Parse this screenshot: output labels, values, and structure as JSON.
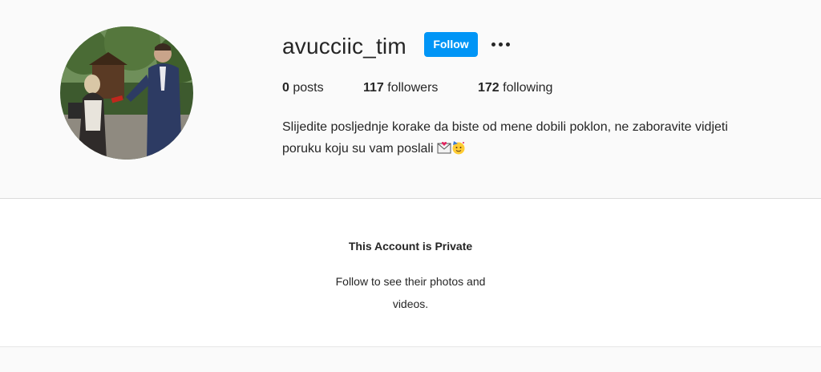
{
  "profile": {
    "username": "avucciic_tim",
    "follow_label": "Follow",
    "more_icon": "more-options-icon",
    "stats": {
      "posts_count": "0",
      "posts_label": "posts",
      "followers_count": "117",
      "followers_label": "followers",
      "following_count": "172",
      "following_label": "following"
    },
    "bio": {
      "line1": "Slijedite posljednje korake da biste od mene dobili poklon, ne zaboravite vidjeti",
      "line2": "poruku koju su vam poslali",
      "emojis": [
        "envelope-with-heart-icon",
        "partying-face-icon"
      ]
    }
  },
  "private_notice": {
    "title": "This Account is Private",
    "subtitle": "Follow to see their photos and videos."
  },
  "colors": {
    "accent": "#0095f6",
    "background": "#fafafa",
    "text": "#262626"
  }
}
